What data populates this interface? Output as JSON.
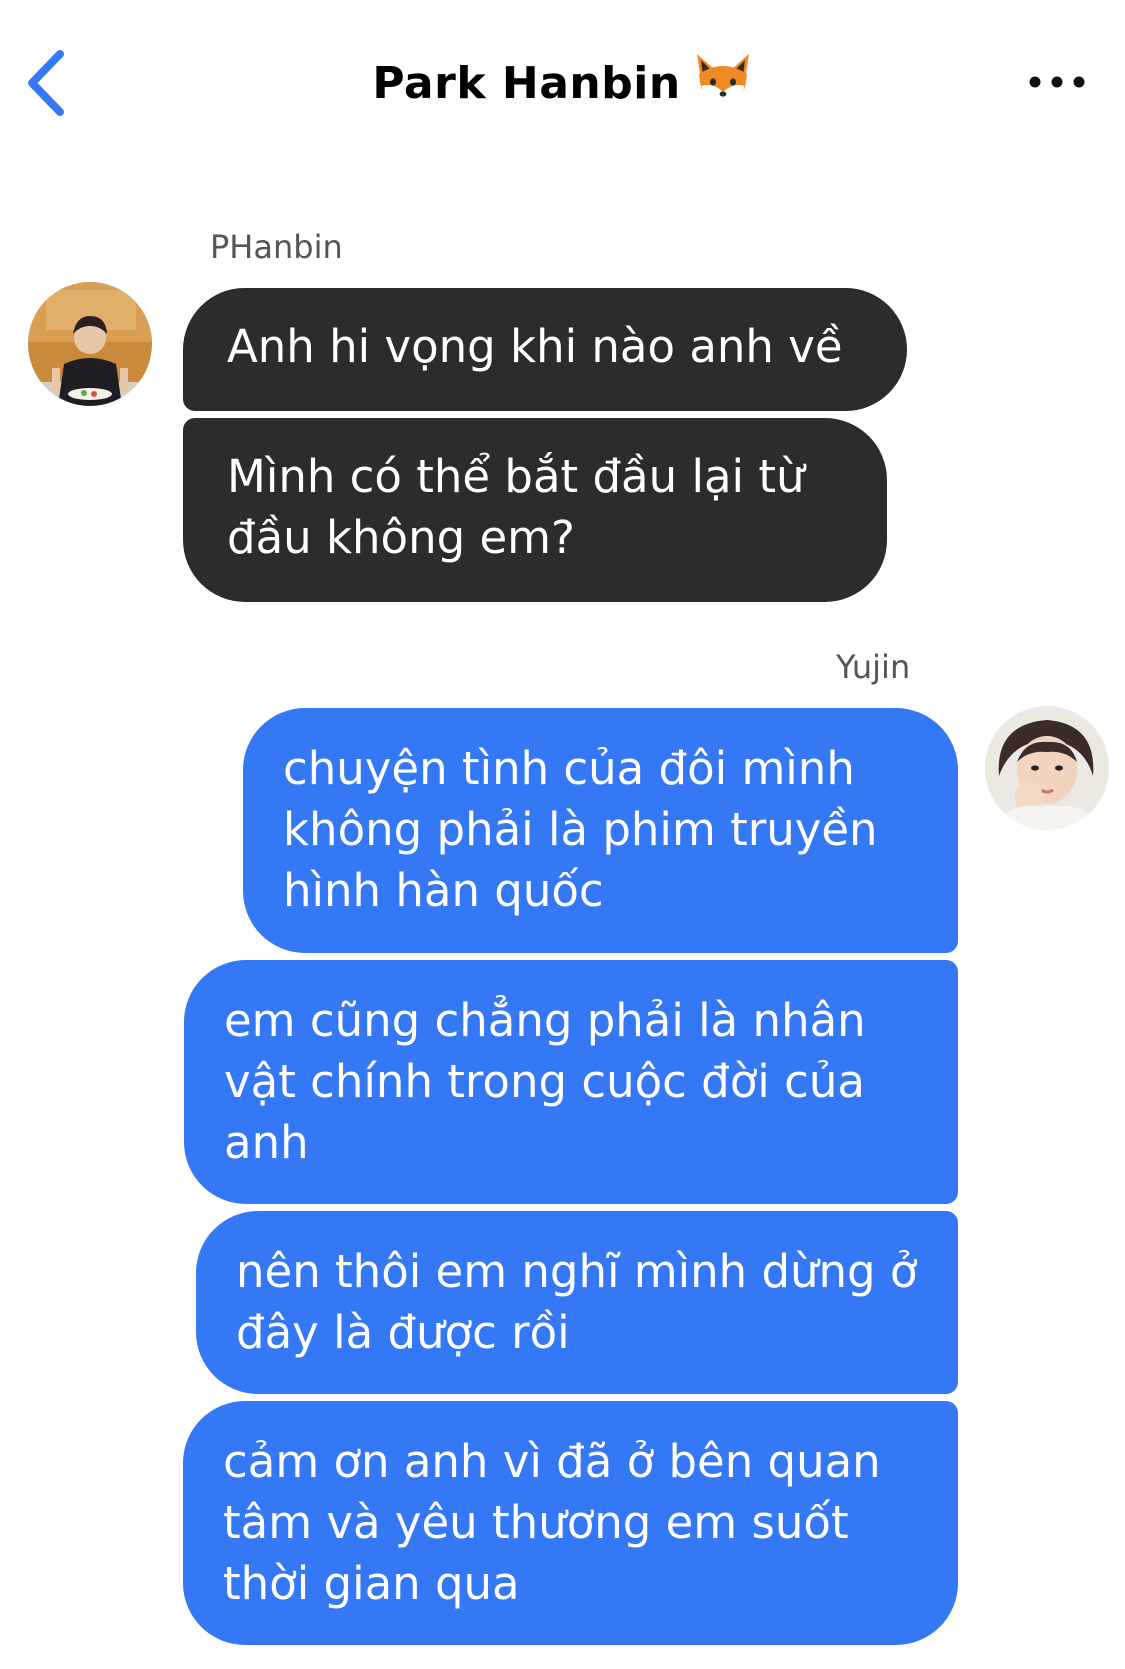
{
  "header": {
    "title": "Park Hanbin",
    "back_icon": "chevron-left-icon",
    "more_icon": "ellipsis-icon",
    "title_emoji_icon": "fox-face-icon",
    "accent_color": "#3478f6"
  },
  "contact": {
    "name": "PHanbin"
  },
  "me": {
    "name": "Yujin"
  },
  "messages": {
    "incoming_1": "Anh hi vọng khi nào anh về",
    "incoming_2": "Mình có thể bắt đầu lại từ đầu không em?",
    "outgoing_1": "chuyện tình của đôi mình không phải là phim truyền hình hàn quốc",
    "outgoing_2": "em cũng chẳng phải là nhân vật chính trong cuộc đời của anh",
    "outgoing_3": "nên thôi em nghĩ mình dừng ở đây là được rồi",
    "outgoing_4": "cảm ơn anh vì đã ở bên quan tâm và yêu thương em suốt thời gian qua"
  },
  "colors": {
    "incoming_bubble": "#2c2c2e",
    "outgoing_bubble": "#3478f6",
    "text_on_bubble": "#ffffff",
    "sender_label": "#555555"
  }
}
